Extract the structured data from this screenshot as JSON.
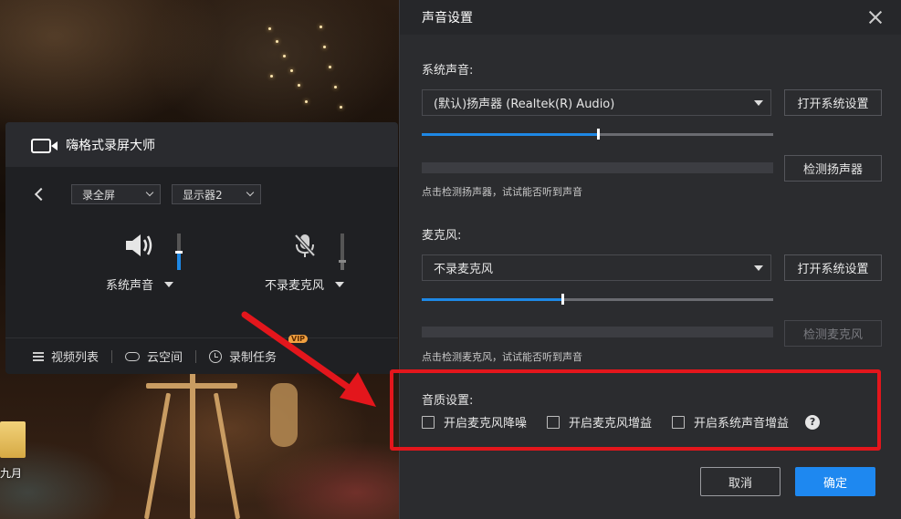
{
  "desktop": {
    "file_label": "九月"
  },
  "recorder": {
    "title": "嗨格式录屏大师",
    "mode_select": "录全屏",
    "display_select": "显示器2",
    "system_audio_label": "系统声音",
    "system_audio_level": 0.45,
    "mic_label": "不录麦克风",
    "mic_level": 0.2,
    "bottom": {
      "video_list": "视频列表",
      "cloud_space": "云空间",
      "record_task": "录制任务",
      "vip_badge": "VIP"
    }
  },
  "dialog": {
    "title": "声音设置",
    "system_sound": {
      "label": "系统声音:",
      "device": "(默认)扬声器 (Realtek(R) Audio)",
      "open_settings_button": "打开系统设置",
      "volume": 0.5,
      "test_button": "检测扬声器",
      "hint": "点击检测扬声器，试试能否听到声音"
    },
    "microphone": {
      "label": "麦克风:",
      "device": "不录麦克风",
      "open_settings_button": "打开系统设置",
      "volume": 0.4,
      "test_button": "检测麦克风",
      "hint": "点击检测麦克风，试试能否听到声音"
    },
    "quality": {
      "label": "音质设置:",
      "options": [
        {
          "label": "开启麦克风降噪",
          "checked": false
        },
        {
          "label": "开启麦克风增益",
          "checked": false
        },
        {
          "label": "开启系统声音增益",
          "checked": false
        }
      ],
      "help_icon": "?"
    },
    "cancel_button": "取消",
    "ok_button": "确定"
  },
  "colors": {
    "accent": "#1e88f0",
    "highlight": "#e3161c",
    "dialog_bg": "#2b2c2f"
  }
}
